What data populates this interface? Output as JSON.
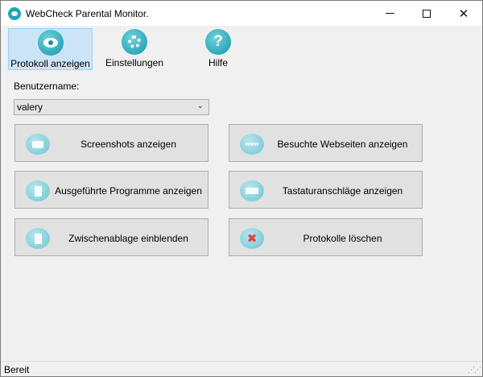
{
  "window": {
    "title": "WebCheck Parental Monitor.",
    "app_icon": "webcheck-eye-icon",
    "controls": {
      "minimize": "minimize-icon",
      "maximize": "maximize-icon",
      "close": "✕"
    }
  },
  "toolbar": {
    "items": [
      {
        "label": "Protokoll anzeigen",
        "icon": "eye-icon",
        "active": true
      },
      {
        "label": "Einstellungen",
        "icon": "gear-icon",
        "active": false
      },
      {
        "label": "Hilfe",
        "icon": "help-icon",
        "glyph": "?",
        "active": false
      }
    ]
  },
  "user": {
    "label": "Benutzername:",
    "selected": "valery"
  },
  "actions": [
    {
      "label": "Screenshots anzeigen",
      "icon": "camera-icon"
    },
    {
      "label": "Besuchte Webseiten anzeigen",
      "icon": "www-icon",
      "glyph": "www"
    },
    {
      "label": "Ausgeführte Programme anzeigen",
      "icon": "programs-icon"
    },
    {
      "label": "Tastaturanschläge anzeigen",
      "icon": "keyboard-icon"
    },
    {
      "label": "Zwischenablage einblenden",
      "icon": "clipboard-icon"
    },
    {
      "label": "Protokolle löschen",
      "icon": "delete-icon",
      "glyph": "✖"
    }
  ],
  "status": {
    "text": "Bereit"
  },
  "colors": {
    "accent": "#1595a6",
    "active_tab": "#cce4f7",
    "button_face": "#e1e1e1"
  }
}
